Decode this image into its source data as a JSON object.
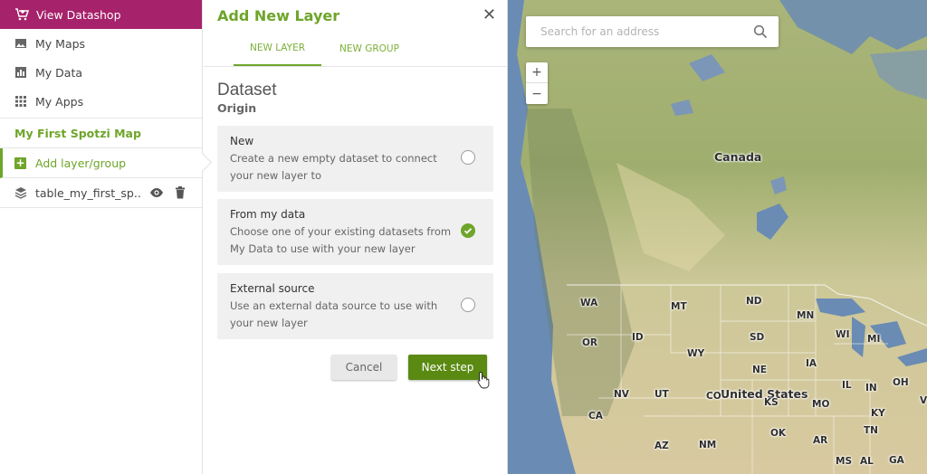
{
  "sidebar": {
    "datashop_label": "View Datashop",
    "nav": [
      {
        "label": "My Maps",
        "icon": "image-icon"
      },
      {
        "label": "My Data",
        "icon": "bar-chart-icon"
      },
      {
        "label": "My Apps",
        "icon": "grid-icon"
      }
    ],
    "map_title": "My First Spotzi Map",
    "add_layer_label": "Add layer/group",
    "layer_name": "table_my_first_sp...",
    "colors": {
      "datashop": "#a6226b",
      "accent": "#6ea52a"
    }
  },
  "panel": {
    "title": "Add New Layer",
    "tabs": [
      "NEW LAYER",
      "NEW GROUP"
    ],
    "section_title": "Dataset",
    "section_subtitle": "Origin",
    "options": [
      {
        "title": "New",
        "desc": "Create a new empty dataset to connect your new layer to",
        "checked": false
      },
      {
        "title": "From my data",
        "desc": "Choose one of your existing datasets from My Data to use with your new layer",
        "checked": true
      },
      {
        "title": "External source",
        "desc": "Use an external data source to use with your new layer",
        "checked": false
      }
    ],
    "cancel_label": "Cancel",
    "next_label": "Next step"
  },
  "map": {
    "search_placeholder": "Search for an address",
    "zoom_in": "+",
    "zoom_out": "−",
    "labels": {
      "canada": "Canada",
      "us": "United States",
      "wa": "WA",
      "mt": "MT",
      "nd": "ND",
      "mn": "MN",
      "or": "OR",
      "id": "ID",
      "sd": "SD",
      "wi": "WI",
      "mi": "MI",
      "wy": "WY",
      "ne": "NE",
      "ia": "IA",
      "nv": "NV",
      "ut": "UT",
      "co": "CO",
      "ks": "KS",
      "mo": "MO",
      "il": "IL",
      "in": "IN",
      "oh": "OH",
      "ca": "CA",
      "ky": "KY",
      "ok": "OK",
      "tn": "TN",
      "az": "AZ",
      "nm": "NM",
      "ar": "AR",
      "ms": "MS",
      "al": "AL",
      "ga": "GA",
      "va": "V"
    }
  }
}
